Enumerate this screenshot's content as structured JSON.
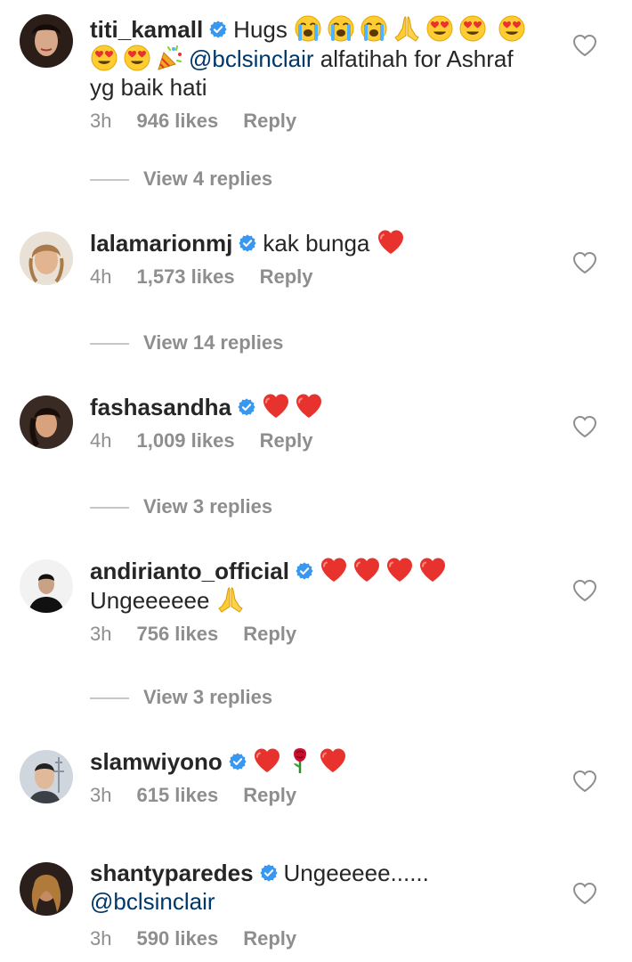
{
  "comments": [
    {
      "username": "titi_kamall",
      "parts": [
        "Hugs",
        "@bclsinclair",
        "alfatihah for Ashraf yg baik hati"
      ],
      "time": "3h",
      "likes": "946 likes",
      "reply_label": "Reply",
      "view_replies": "View 4 replies"
    },
    {
      "username": "lalamarionmj",
      "parts": [
        "kak bunga"
      ],
      "time": "4h",
      "likes": "1,573 likes",
      "reply_label": "Reply",
      "view_replies": "View 14 replies"
    },
    {
      "username": "fashasandha",
      "parts": [],
      "time": "4h",
      "likes": "1,009 likes",
      "reply_label": "Reply",
      "view_replies": "View 3 replies"
    },
    {
      "username": "andirianto_official",
      "parts": [
        "Ungeeeeee"
      ],
      "time": "3h",
      "likes": "756 likes",
      "reply_label": "Reply",
      "view_replies": "View 3 replies"
    },
    {
      "username": "slamwiyono",
      "parts": [],
      "time": "3h",
      "likes": "615 likes",
      "reply_label": "Reply"
    },
    {
      "username": "shantyparedes",
      "parts": [
        "Ungeeeee......",
        "@bclsinclair"
      ],
      "time": "3h",
      "likes": "590 likes",
      "reply_label": "Reply"
    }
  ],
  "icons": {
    "verified": "verified-badge-icon",
    "like": "heart-outline-icon",
    "emoji_crying": "loudly-crying-face-icon",
    "emoji_pray": "folded-hands-icon",
    "emoji_heart_eyes": "heart-eyes-face-icon",
    "emoji_party": "party-popper-icon",
    "emoji_heart": "red-heart-icon",
    "emoji_rose": "rose-icon"
  },
  "colors": {
    "text": "#262626",
    "meta": "#8e8e8e",
    "mention": "#00376b",
    "verified": "#3897f0",
    "heart_emoji": "#e8322d"
  }
}
